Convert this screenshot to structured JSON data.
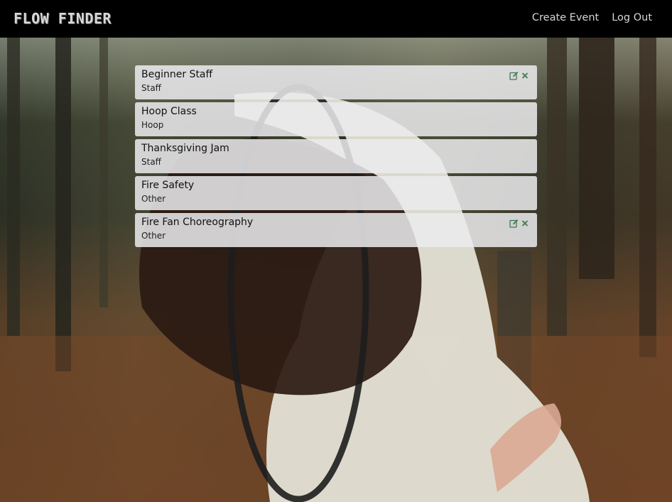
{
  "navbar": {
    "brand": "FLOW FINDER",
    "links": [
      {
        "label": "Create Event"
      },
      {
        "label": "Log Out"
      }
    ]
  },
  "events": [
    {
      "name": "Beginner Staff",
      "category": "Staff",
      "editable": true
    },
    {
      "name": "Hoop Class",
      "category": "Hoop",
      "editable": false
    },
    {
      "name": "Thanksgiving Jam",
      "category": "Staff",
      "editable": false
    },
    {
      "name": "Fire Safety",
      "category": "Other",
      "editable": false
    },
    {
      "name": "Fire Fan Choreography",
      "category": "Other",
      "editable": true
    }
  ],
  "icons": {
    "edit": "edit-icon",
    "delete": "close-icon"
  },
  "colors": {
    "navbar_bg": "#000000",
    "card_bg": "#ebebee",
    "action_icon": "#3f7a4f"
  },
  "background_image": "forest-woman-hoop-photo"
}
